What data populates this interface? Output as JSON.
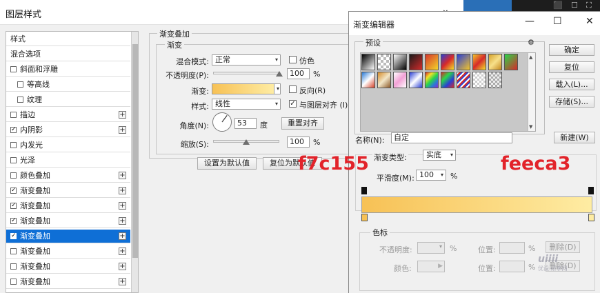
{
  "main_window": {
    "title": "图层样式",
    "close_glyph": "⌄",
    "bg_glyphs": [
      "⬛",
      "☐",
      "⛶"
    ]
  },
  "style_list": {
    "items": [
      {
        "label": "样式",
        "has_checkbox": false,
        "checked": false,
        "has_plus": false,
        "selected": false,
        "indent": false
      },
      {
        "label": "混合选项",
        "has_checkbox": false,
        "checked": false,
        "has_plus": false,
        "selected": false,
        "indent": false
      },
      {
        "label": "斜面和浮雕",
        "has_checkbox": true,
        "checked": false,
        "has_plus": false,
        "selected": false,
        "indent": false
      },
      {
        "label": "等高线",
        "has_checkbox": true,
        "checked": false,
        "has_plus": false,
        "selected": false,
        "indent": true
      },
      {
        "label": "纹理",
        "has_checkbox": true,
        "checked": false,
        "has_plus": false,
        "selected": false,
        "indent": true
      },
      {
        "label": "描边",
        "has_checkbox": true,
        "checked": false,
        "has_plus": true,
        "selected": false,
        "indent": false
      },
      {
        "label": "内阴影",
        "has_checkbox": true,
        "checked": true,
        "has_plus": true,
        "selected": false,
        "indent": false
      },
      {
        "label": "内发光",
        "has_checkbox": true,
        "checked": false,
        "has_plus": false,
        "selected": false,
        "indent": false
      },
      {
        "label": "光泽",
        "has_checkbox": true,
        "checked": false,
        "has_plus": false,
        "selected": false,
        "indent": false
      },
      {
        "label": "颜色叠加",
        "has_checkbox": true,
        "checked": false,
        "has_plus": true,
        "selected": false,
        "indent": false
      },
      {
        "label": "渐变叠加",
        "has_checkbox": true,
        "checked": true,
        "has_plus": true,
        "selected": false,
        "indent": false
      },
      {
        "label": "渐变叠加",
        "has_checkbox": true,
        "checked": true,
        "has_plus": true,
        "selected": false,
        "indent": false
      },
      {
        "label": "渐变叠加",
        "has_checkbox": true,
        "checked": true,
        "has_plus": true,
        "selected": false,
        "indent": false
      },
      {
        "label": "渐变叠加",
        "has_checkbox": true,
        "checked": true,
        "has_plus": true,
        "selected": true,
        "indent": false
      },
      {
        "label": "渐变叠加",
        "has_checkbox": true,
        "checked": false,
        "has_plus": true,
        "selected": false,
        "indent": false
      },
      {
        "label": "渐变叠加",
        "has_checkbox": true,
        "checked": false,
        "has_plus": true,
        "selected": false,
        "indent": false
      },
      {
        "label": "渐变叠加",
        "has_checkbox": true,
        "checked": false,
        "has_plus": true,
        "selected": false,
        "indent": false
      }
    ],
    "check_glyph": "✓",
    "plus_glyph": "+"
  },
  "gradient_overlay": {
    "section_title": "渐变叠加",
    "group_title": "渐变",
    "blend_mode_label": "混合模式:",
    "blend_mode_value": "正常",
    "dither_label": "仿色",
    "dither_checked": false,
    "opacity_label": "不透明度(P):",
    "opacity_value": "100",
    "opacity_unit": "%",
    "opacity_fraction": 1.0,
    "gradient_label": "渐变:",
    "reverse_label": "反向(R)",
    "reverse_checked": false,
    "style_label": "样式:",
    "style_value": "线性",
    "align_label": "与图层对齐 (I)",
    "align_checked": true,
    "angle_label": "角度(N):",
    "angle_value": "53",
    "angle_unit": "度",
    "reset_align_button": "重置对齐",
    "scale_label": "缩放(S):",
    "scale_value": "100",
    "scale_unit": "%",
    "scale_fraction": 0.5,
    "set_default_button": "设置为默认值",
    "reset_default_button": "复位为默认值",
    "dropdown_arrow": "▾",
    "check_glyph": "✓"
  },
  "gradient_editor": {
    "title": "渐变编辑器",
    "minimize_glyph": "—",
    "maximize_glyph": "☐",
    "close_glyph": "✕",
    "presets_label": "预设",
    "gear_icon": "⚙",
    "ok_button": "确定",
    "reset_button": "复位",
    "load_button": "载入(L)...",
    "save_button": "存储(S)...",
    "name_label": "名称(N):",
    "name_value": "自定",
    "new_button": "新建(W)",
    "gradient_type_label": "渐变类型:",
    "gradient_type_value": "实底",
    "smoothness_label": "平滑度(M):",
    "smoothness_value": "100",
    "smoothness_unit": "%",
    "color_stops_title": "色标",
    "stop_opacity_label": "不透明度:",
    "stop_percent": "%",
    "stop_location_label": "位置:",
    "delete_button": "删除(D)",
    "color_label": "颜色:",
    "location_label_2": "位置:",
    "delete_button_2": "删除(D)",
    "dropdown_arrow": "▾",
    "scroll_up": "▲",
    "scroll_down": "▼"
  },
  "gradient": {
    "start_color": "#f7c155",
    "end_color": "#feeca3"
  },
  "annotations": {
    "left_hex": "f7c155",
    "right_hex": "feeca3"
  },
  "watermark": {
    "logo": "uiiii",
    "caption": "优设.研享网"
  },
  "colors": {
    "selection_blue": "#0f6fd6",
    "annotation_red": "#e2232a"
  }
}
